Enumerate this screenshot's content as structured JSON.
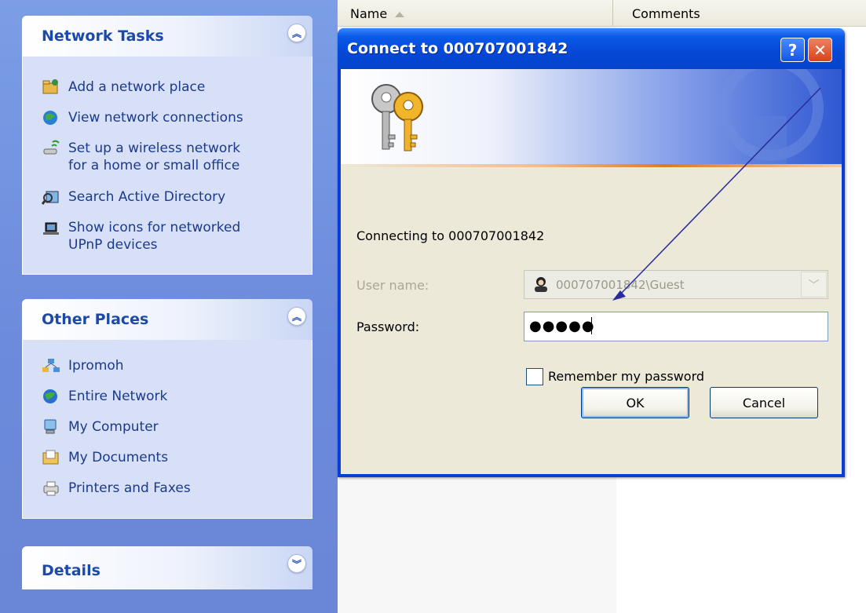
{
  "task_pane": {
    "network_tasks": {
      "title": "Network Tasks",
      "items": [
        {
          "label": "Add a network place",
          "icon": "add-network-place-icon"
        },
        {
          "label": "View network connections",
          "icon": "network-connections-icon"
        },
        {
          "label": "Set up a wireless network",
          "label2": "for a home or small office",
          "icon": "wireless-network-icon"
        },
        {
          "label": "Search Active Directory",
          "icon": "search-directory-icon"
        },
        {
          "label": "Show icons for networked",
          "label2": "UPnP devices",
          "icon": "upnp-devices-icon"
        }
      ]
    },
    "other_places": {
      "title": "Other Places",
      "items": [
        {
          "label": "Ipromoh",
          "icon": "workgroup-icon"
        },
        {
          "label": "Entire Network",
          "icon": "entire-network-icon"
        },
        {
          "label": "My Computer",
          "icon": "my-computer-icon"
        },
        {
          "label": "My Documents",
          "icon": "my-documents-icon"
        },
        {
          "label": "Printers and Faxes",
          "icon": "printers-faxes-icon"
        }
      ]
    },
    "details": {
      "title": "Details"
    }
  },
  "list_header": {
    "name": "Name",
    "comments": "Comments"
  },
  "dialog": {
    "title": "Connect to 000707001842",
    "help_symbol": "?",
    "close_symbol": "✕",
    "connecting_text": "Connecting to 000707001842",
    "username_label": "User name:",
    "username_value": "000707001842\\Guest",
    "password_label": "Password:",
    "password_value": "●●●●●",
    "remember_label": "Remember my password",
    "remember_checked": false,
    "ok_label": "OK",
    "cancel_label": "Cancel"
  }
}
